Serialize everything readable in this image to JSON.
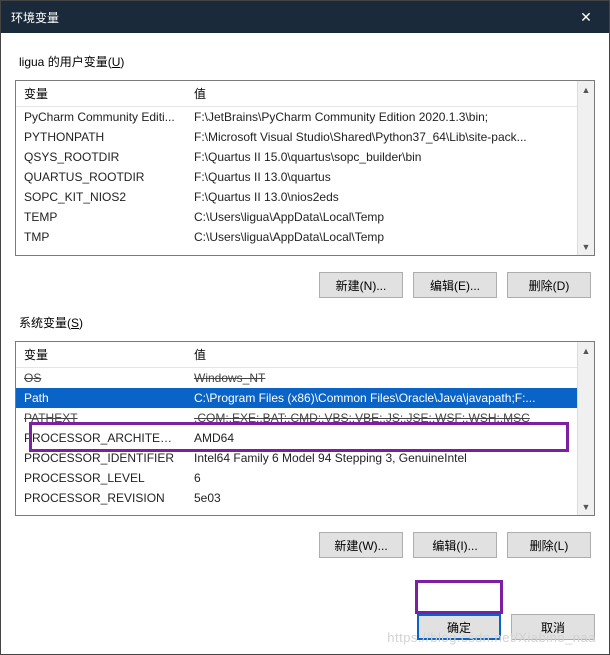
{
  "title": "环境变量",
  "close_glyph": "✕",
  "user_section": {
    "label_prefix": "ligua 的用户变量(",
    "label_key": "U",
    "label_suffix": ")",
    "col_name": "变量",
    "col_value": "值",
    "rows": [
      {
        "name": "PyCharm Community Editi...",
        "value": "F:\\JetBrains\\PyCharm Community Edition 2020.1.3\\bin;"
      },
      {
        "name": "PYTHONPATH",
        "value": "F:\\Microsoft Visual Studio\\Shared\\Python37_64\\Lib\\site-pack..."
      },
      {
        "name": "QSYS_ROOTDIR",
        "value": "F:\\Quartus II 15.0\\quartus\\sopc_builder\\bin"
      },
      {
        "name": "QUARTUS_ROOTDIR",
        "value": "F:\\Quartus II 13.0\\quartus"
      },
      {
        "name": "SOPC_KIT_NIOS2",
        "value": "F:\\Quartus II 13.0\\nios2eds"
      },
      {
        "name": "TEMP",
        "value": "C:\\Users\\ligua\\AppData\\Local\\Temp"
      },
      {
        "name": "TMP",
        "value": "C:\\Users\\ligua\\AppData\\Local\\Temp"
      }
    ],
    "buttons": {
      "new": "新建(N)...",
      "edit": "编辑(E)...",
      "delete": "删除(D)"
    }
  },
  "system_section": {
    "label_prefix": "系统变量(",
    "label_key": "S",
    "label_suffix": ")",
    "col_name": "变量",
    "col_value": "值",
    "rows": [
      {
        "name": "OS",
        "value": "Windows_NT",
        "strike": true
      },
      {
        "name": "Path",
        "value": "C:\\Program Files (x86)\\Common Files\\Oracle\\Java\\javapath;F:...",
        "selected": true
      },
      {
        "name": "PATHEXT",
        "value": ".COM;.EXE;.BAT;.CMD;.VBS;.VBE;.JS;.JSE;.WSF;.WSH;.MSC",
        "strike": true
      },
      {
        "name": "PROCESSOR_ARCHITECT...",
        "value": "AMD64"
      },
      {
        "name": "PROCESSOR_IDENTIFIER",
        "value": "Intel64 Family 6 Model 94 Stepping 3, GenuineIntel"
      },
      {
        "name": "PROCESSOR_LEVEL",
        "value": "6"
      },
      {
        "name": "PROCESSOR_REVISION",
        "value": "5e03"
      }
    ],
    "buttons": {
      "new": "新建(W)...",
      "edit": "编辑(I)...",
      "delete": "删除(L)"
    }
  },
  "footer": {
    "ok": "确定",
    "cancel": "取消"
  },
  "scroll": {
    "up": "▲",
    "down": "▼"
  },
  "watermark": "https://blog.csdn.net/Xiabino_naa"
}
